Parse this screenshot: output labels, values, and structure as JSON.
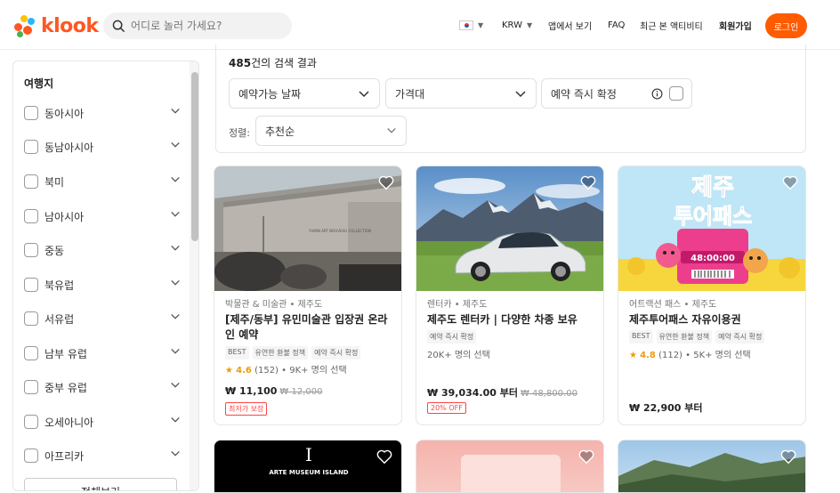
{
  "header": {
    "logo_text": "klook",
    "search_placeholder": "어디로 놀러 가세요?",
    "currency": "KRW",
    "app_link": "앱에서 보기",
    "faq": "FAQ",
    "recent": "최근 본 액티비티",
    "signup": "회원가입",
    "login": "로그인"
  },
  "sidebar": {
    "title": "여행지",
    "items": [
      "동아시아",
      "동남아시아",
      "북미",
      "남아시아",
      "중동",
      "북유럽",
      "서유럽",
      "남부 유럽",
      "중부 유럽",
      "오세아니아",
      "아프리카"
    ],
    "show_more": "전체보기"
  },
  "filters": {
    "result_count": "485",
    "result_suffix": "건의 검색 결과",
    "date": "예약가능 날짜",
    "price": "가격대",
    "instant": "예약 즉시 확정",
    "sort_label": "정렬:",
    "sort_value": "추천순"
  },
  "cards": [
    {
      "category": "박물관 & 미술관 • 제주도",
      "title": "[제주/동부] 유민미술관 입장권 온라인 예약",
      "tags": [
        "BEST",
        "유연한 환불 정책",
        "예약 즉시 확정"
      ],
      "rating": "4.6",
      "reviews": "(152) • 9K+ 명의 선택",
      "price": "₩ 11,100",
      "old_price": "₩ 12,000",
      "badge": "최저가 보장",
      "image_sign": "YUMIN ART NOUVEAU COLLECTION"
    },
    {
      "category": "렌터카 • 제주도",
      "title": "제주도 렌터카 | 다양한 차종 보유",
      "tags": [
        "예약 즉시 확정"
      ],
      "booked": "20K+ 명의 선택",
      "price": "₩ 39,034.00 부터",
      "old_price": "₩ 48,800.00",
      "badge": "20% OFF"
    },
    {
      "category": "어트랙션 패스 • 제주도",
      "title": "제주투어패스 자유이용권",
      "tags": [
        "BEST",
        "유연한 환불 정책",
        "예약 즉시 확정"
      ],
      "rating": "4.8",
      "reviews": "(112) • 5K+ 명의 선택",
      "price": "₩ 22,900 부터",
      "image_title_1": "제주",
      "image_title_2": "투어패스",
      "image_timer": "48:00:00"
    }
  ],
  "row2": {
    "arte_title": "ARTE MUSEUM ISLAND",
    "arte_letter": "I"
  }
}
